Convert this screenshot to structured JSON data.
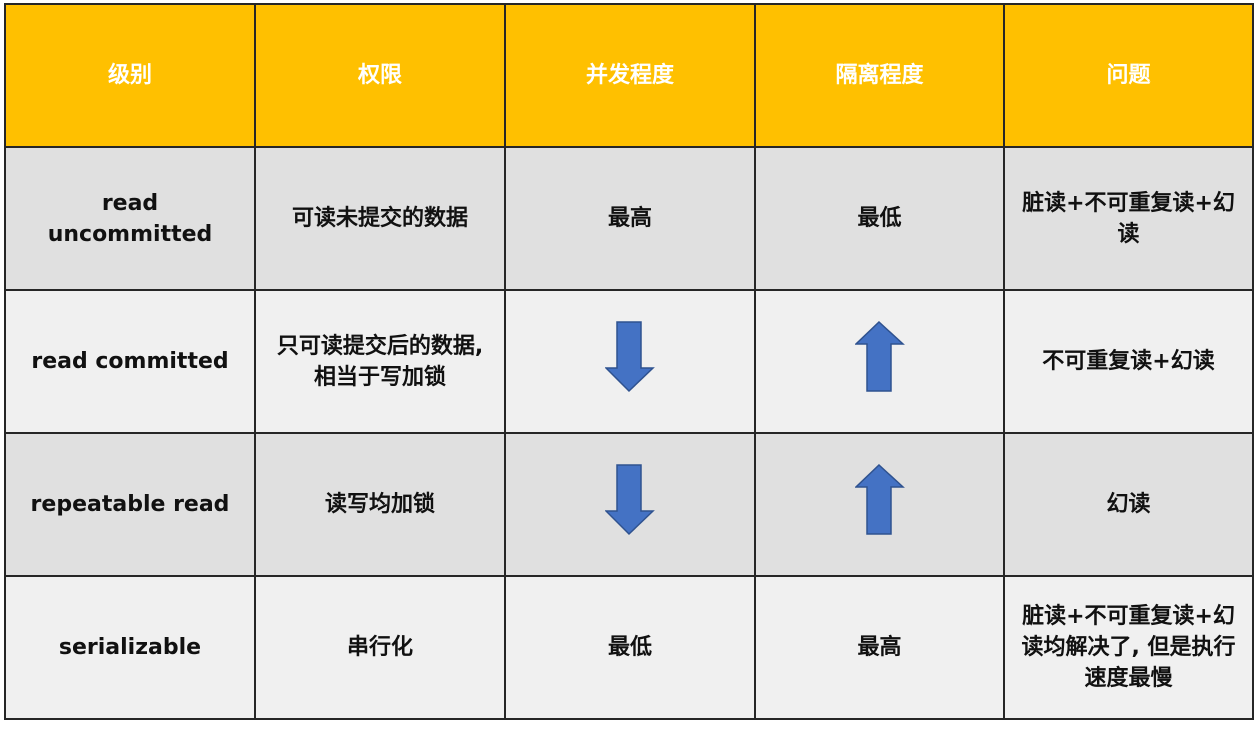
{
  "colors": {
    "header_bg": "#ffc000",
    "header_text": "#ffffff",
    "row_odd_bg": "#e0e0e0",
    "row_even_bg": "#f0f0f0",
    "arrow_fill": "#4472c4",
    "arrow_stroke": "#2f528f"
  },
  "table": {
    "headers": [
      "级别",
      "权限",
      "并发程度",
      "隔离程度",
      "问题"
    ],
    "rows": [
      {
        "level": "read uncommitted",
        "permission": "可读未提交的数据",
        "concurrency": "最高",
        "isolation": "最低",
        "issues": "脏读+不可重复读+幻读"
      },
      {
        "level": "read committed",
        "permission": "只可读提交后的数据,相当于写加锁",
        "concurrency_icon": "arrow-down-icon",
        "isolation_icon": "arrow-up-icon",
        "issues": "不可重复读+幻读"
      },
      {
        "level": "repeatable read",
        "permission": "读写均加锁",
        "concurrency_icon": "arrow-down-icon",
        "isolation_icon": "arrow-up-icon",
        "issues": "幻读"
      },
      {
        "level": "serializable",
        "permission": "串行化",
        "concurrency": "最低",
        "isolation": "最高",
        "issues": "脏读+不可重复读+幻读均解决了, 但是执行速度最慢"
      }
    ]
  }
}
